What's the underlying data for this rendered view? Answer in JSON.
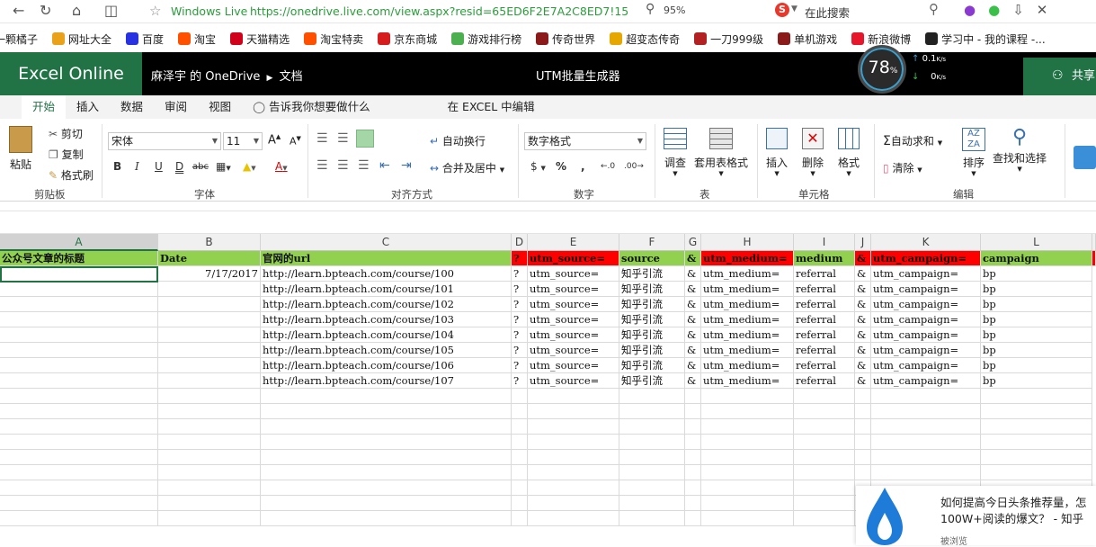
{
  "browser": {
    "wl_label": "Windows Live",
    "url": "https://onedrive.live.com/view.aspx?resid=65ED6F2E7A2C8ED7!159",
    "zoom": "95%",
    "search_placeholder": "在此搜索"
  },
  "bookmarks": [
    {
      "label": "一颗橘子",
      "color": "#f08c1a",
      "icon": "orange-icon"
    },
    {
      "label": "网址大全",
      "color": "#e9a21a",
      "icon": "hao-icon"
    },
    {
      "label": "百度",
      "color": "#2932e1",
      "icon": "baidu-icon"
    },
    {
      "label": "淘宝",
      "color": "#ff5000",
      "icon": "taobao-icon"
    },
    {
      "label": "天猫精选",
      "color": "#d0021b",
      "icon": "tmall-icon"
    },
    {
      "label": "淘宝特卖",
      "color": "#ff5000",
      "icon": "taobao-sale-icon"
    },
    {
      "label": "京东商城",
      "color": "#d71c1e",
      "icon": "jd-icon"
    },
    {
      "label": "游戏排行榜",
      "color": "#4caf50",
      "icon": "gamepad-icon"
    },
    {
      "label": "传奇世界",
      "color": "#8b1a1a",
      "icon": "game-icon"
    },
    {
      "label": "超变态传奇",
      "color": "#e6a800",
      "icon": "game-icon"
    },
    {
      "label": "一刀999级",
      "color": "#b22222",
      "icon": "game-icon"
    },
    {
      "label": "单机游戏",
      "color": "#8b1a1a",
      "icon": "game-icon"
    },
    {
      "label": "新浪微博",
      "color": "#e6162d",
      "icon": "weibo-icon"
    },
    {
      "label": "学习中 - 我的课程 -...",
      "color": "#222222",
      "icon": "course-icon"
    }
  ],
  "excel": {
    "brand": "Excel Online",
    "breadcrumb_owner": "麻泽宇 的 OneDrive",
    "breadcrumb_folder": "文档",
    "doc_title": "UTM批量生成器",
    "share_label": "共享",
    "speed_percent": "78",
    "speed_up": "0.1",
    "speed_down": "0",
    "speed_unit": "K/s"
  },
  "tabs": [
    "开始",
    "插入",
    "数据",
    "审阅",
    "视图",
    "告诉我你想要做什么",
    "在 EXCEL 中编辑"
  ],
  "ribbon": {
    "paste": "粘贴",
    "cut": "剪切",
    "copy": "复制",
    "format_painter": "格式刷",
    "clipboard": "剪贴板",
    "font_name": "宋体",
    "font_size": "11",
    "font_group": "字体",
    "bold": "B",
    "italic": "I",
    "underline": "U",
    "double_underline": "D",
    "strike": "abc",
    "wrap": "自动换行",
    "merge": "合并及居中",
    "align_group": "对齐方式",
    "num_format": "数字格式",
    "currency": "$",
    "percent": "%",
    "comma": ",",
    "number_group": "数字",
    "adjust": "调查",
    "table_format": "套用表格式",
    "table_group": "表",
    "insert": "插入",
    "delete": "删除",
    "format": "格式",
    "cells_group": "单元格",
    "autosum": "自动求和",
    "clear": "清除",
    "sort": "排序",
    "find": "查找和选择",
    "edit_group": "编辑"
  },
  "columns": [
    "A",
    "B",
    "C",
    "D",
    "E",
    "F",
    "G",
    "H",
    "I",
    "J",
    "K",
    "L"
  ],
  "header_row": [
    "公众号文章的标题",
    "Date",
    "官网的url",
    "?",
    "utm_source=",
    "source",
    "&",
    "utm_medium=",
    "medium",
    "&",
    "utm_campaign=",
    "campaign"
  ],
  "header_colors": [
    "#92d050",
    "#92d050",
    "#92d050",
    "#ff0000",
    "#ff0000",
    "#92d050",
    "#92d050",
    "#ff0000",
    "#92d050",
    "#ff0000",
    "#ff0000",
    "#92d050"
  ],
  "rows": [
    [
      "",
      "7/17/2017",
      "http://learn.bpteach.com/course/100",
      "?",
      "utm_source=",
      "知乎引流",
      "&",
      "utm_medium=",
      "referral",
      "&",
      "utm_campaign=",
      "bp"
    ],
    [
      "",
      "",
      "http://learn.bpteach.com/course/101",
      "?",
      "utm_source=",
      "知乎引流",
      "&",
      "utm_medium=",
      "referral",
      "&",
      "utm_campaign=",
      "bp"
    ],
    [
      "",
      "",
      "http://learn.bpteach.com/course/102",
      "?",
      "utm_source=",
      "知乎引流",
      "&",
      "utm_medium=",
      "referral",
      "&",
      "utm_campaign=",
      "bp"
    ],
    [
      "",
      "",
      "http://learn.bpteach.com/course/103",
      "?",
      "utm_source=",
      "知乎引流",
      "&",
      "utm_medium=",
      "referral",
      "&",
      "utm_campaign=",
      "bp"
    ],
    [
      "",
      "",
      "http://learn.bpteach.com/course/104",
      "?",
      "utm_source=",
      "知乎引流",
      "&",
      "utm_medium=",
      "referral",
      "&",
      "utm_campaign=",
      "bp"
    ],
    [
      "",
      "",
      "http://learn.bpteach.com/course/105",
      "?",
      "utm_source=",
      "知乎引流",
      "&",
      "utm_medium=",
      "referral",
      "&",
      "utm_campaign=",
      "bp"
    ],
    [
      "",
      "",
      "http://learn.bpteach.com/course/106",
      "?",
      "utm_source=",
      "知乎引流",
      "&",
      "utm_medium=",
      "referral",
      "&",
      "utm_campaign=",
      "bp"
    ],
    [
      "",
      "",
      "http://learn.bpteach.com/course/107",
      "?",
      "utm_source=",
      "知乎引流",
      "&",
      "utm_medium=",
      "referral",
      "&",
      "utm_campaign=",
      "bp"
    ]
  ],
  "notification": {
    "line1": "如何提高今日头条推荐量，怎",
    "line2": "100W+阅读的爆文？ - 知乎",
    "sub": "被浏览"
  }
}
